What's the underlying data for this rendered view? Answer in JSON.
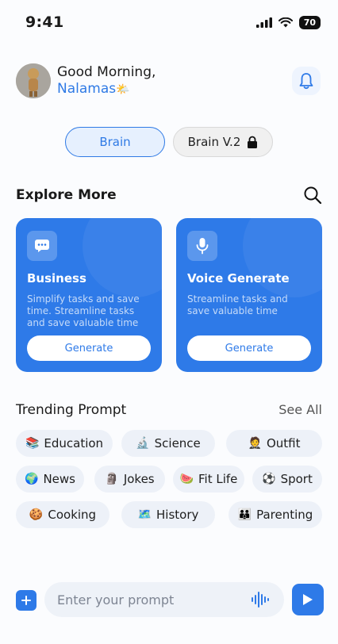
{
  "status_bar": {
    "time": "9:41",
    "battery": "70"
  },
  "header": {
    "greeting": "Good Morning,",
    "user_name": "Nalamas",
    "user_emoji": "🌤️"
  },
  "modes": [
    {
      "label": "Brain",
      "active": true
    },
    {
      "label": "Brain V.2",
      "locked": true,
      "active": false
    }
  ],
  "explore": {
    "title": "Explore More",
    "cards": [
      {
        "title": "Business",
        "description": "Simplify tasks and save time. Streamline tasks and save valuable time",
        "button": "Generate",
        "icon": "chat-icon"
      },
      {
        "title": "Voice Generate",
        "description": "Streamline tasks and save valuable time",
        "button": "Generate",
        "icon": "microphone-icon"
      }
    ]
  },
  "trending": {
    "title": "Trending Prompt",
    "see_all": "See All",
    "chips": [
      {
        "emoji": "📚",
        "label": "Education"
      },
      {
        "emoji": "🔬",
        "label": "Science"
      },
      {
        "emoji": "🤵",
        "label": "Outfit"
      },
      {
        "emoji": "🌍",
        "label": "News"
      },
      {
        "emoji": "🗿",
        "label": "Jokes"
      },
      {
        "emoji": "🍉",
        "label": "Fit Life"
      },
      {
        "emoji": "⚽",
        "label": "Sport"
      },
      {
        "emoji": "🍪",
        "label": "Cooking"
      },
      {
        "emoji": "🗺️",
        "label": "History"
      },
      {
        "emoji": "👪",
        "label": "Parenting"
      }
    ]
  },
  "prompt": {
    "placeholder": "Enter your prompt"
  },
  "colors": {
    "accent": "#2E7AE8",
    "chip_bg": "#EDF1F8"
  }
}
